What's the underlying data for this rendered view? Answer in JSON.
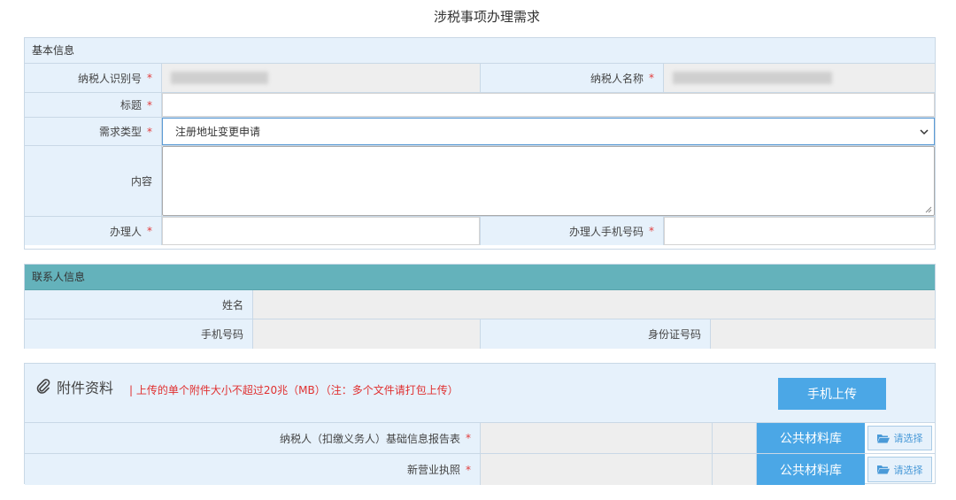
{
  "page": {
    "title": "涉税事项办理需求"
  },
  "basic": {
    "header": "基本信息",
    "taxpayer_id_label": "纳税人识别号",
    "taxpayer_name_label": "纳税人名称",
    "subject_label": "标题",
    "subject_value": "",
    "request_type_label": "需求类型",
    "request_type_value": "注册地址变更申请",
    "content_label": "内容",
    "content_value": "",
    "handler_label": "办理人",
    "handler_value": "",
    "handler_phone_label": "办理人手机号码",
    "handler_phone_value": "",
    "required_mark": "*"
  },
  "contact": {
    "header": "联系人信息",
    "name_label": "姓名",
    "phone_label": "手机号码",
    "id_label": "身份证号码"
  },
  "attachments": {
    "title": "附件资料",
    "note": "| 上传的单个附件大小不超过20兆（MB）（注：多个文件请打包上传）",
    "mobile_upload_label": "手机上传",
    "items": [
      {
        "label": "纳税人（扣缴义务人）基础信息报告表",
        "library_label": "公共材料库",
        "choose_label": "请选择"
      },
      {
        "label": "新营业执照",
        "library_label": "公共材料库",
        "choose_label": "请选择"
      }
    ]
  },
  "colors": {
    "accent_blue": "#4ba7e6",
    "label_bg": "#e6f1fb",
    "teal_header": "#64b2bb",
    "required_red": "#e23b3b"
  }
}
